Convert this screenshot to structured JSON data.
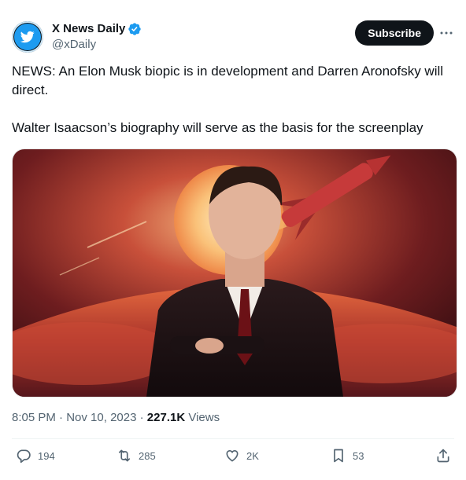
{
  "author": {
    "display_name": "X News Daily",
    "handle": "@xDaily",
    "verified": true,
    "avatar_icon": "twitter-bird-icon",
    "verified_icon": "verified-badge-icon"
  },
  "header": {
    "subscribe_label": "Subscribe",
    "more_icon": "more-dots-icon"
  },
  "tweet": {
    "paragraph_1": "NEWS: An Elon Musk biopic is in development and Darren Aronofsky will direct.",
    "paragraph_2": "Walter Isaacson’s biography will serve as the basis for the screenplay"
  },
  "meta": {
    "time": "8:05 PM",
    "separator": " · ",
    "date": "Nov 10, 2023",
    "separator2": " · ",
    "views_count": "227.1K",
    "views_label": " Views"
  },
  "actions": {
    "replies": "194",
    "reposts": "285",
    "likes": "2K",
    "bookmarks": "53"
  },
  "colors": {
    "accent": "#1d9bf0",
    "text": "#0f1419",
    "secondary": "#536471"
  }
}
